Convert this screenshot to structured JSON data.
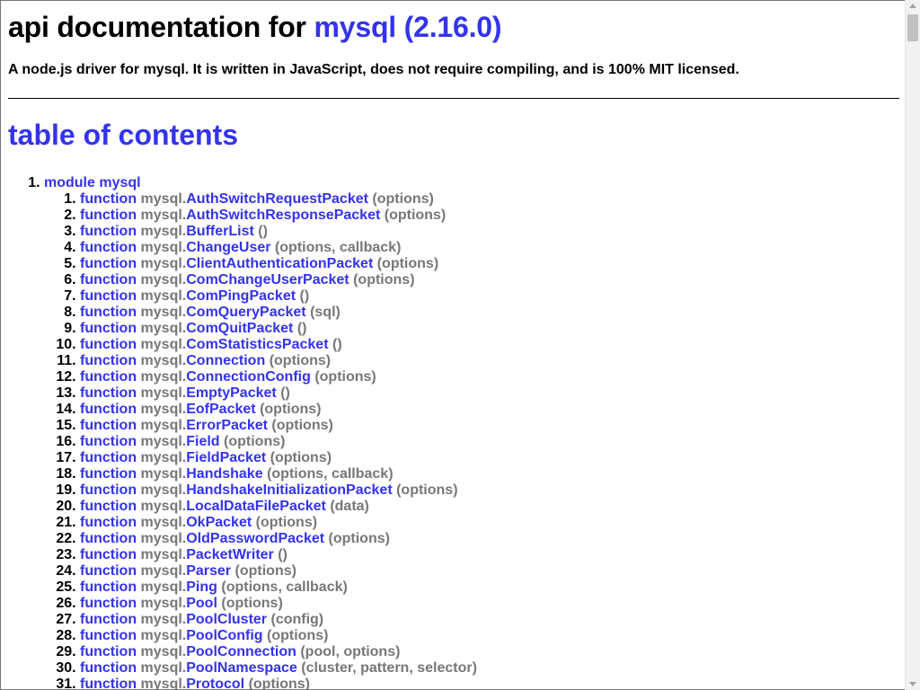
{
  "title": {
    "prefix": "api documentation for ",
    "link": "mysql (2.16.0)"
  },
  "description": "A node.js driver for mysql. It is written in JavaScript, does not require compiling, and is 100% MIT licensed.",
  "toc_heading": "table of contents",
  "module": {
    "label": "module mysql",
    "keyword": "function",
    "namespace": "mysql.",
    "functions": [
      {
        "name": "AuthSwitchRequestPacket",
        "args": "(options)"
      },
      {
        "name": "AuthSwitchResponsePacket",
        "args": "(options)"
      },
      {
        "name": "BufferList",
        "args": "()"
      },
      {
        "name": "ChangeUser",
        "args": "(options, callback)"
      },
      {
        "name": "ClientAuthenticationPacket",
        "args": "(options)"
      },
      {
        "name": "ComChangeUserPacket",
        "args": "(options)"
      },
      {
        "name": "ComPingPacket",
        "args": "()"
      },
      {
        "name": "ComQueryPacket",
        "args": "(sql)"
      },
      {
        "name": "ComQuitPacket",
        "args": "()"
      },
      {
        "name": "ComStatisticsPacket",
        "args": "()"
      },
      {
        "name": "Connection",
        "args": "(options)"
      },
      {
        "name": "ConnectionConfig",
        "args": "(options)"
      },
      {
        "name": "EmptyPacket",
        "args": "()"
      },
      {
        "name": "EofPacket",
        "args": "(options)"
      },
      {
        "name": "ErrorPacket",
        "args": "(options)"
      },
      {
        "name": "Field",
        "args": "(options)"
      },
      {
        "name": "FieldPacket",
        "args": "(options)"
      },
      {
        "name": "Handshake",
        "args": "(options, callback)"
      },
      {
        "name": "HandshakeInitializationPacket",
        "args": "(options)"
      },
      {
        "name": "LocalDataFilePacket",
        "args": "(data)"
      },
      {
        "name": "OkPacket",
        "args": "(options)"
      },
      {
        "name": "OldPasswordPacket",
        "args": "(options)"
      },
      {
        "name": "PacketWriter",
        "args": "()"
      },
      {
        "name": "Parser",
        "args": "(options)"
      },
      {
        "name": "Ping",
        "args": "(options, callback)"
      },
      {
        "name": "Pool",
        "args": "(options)"
      },
      {
        "name": "PoolCluster",
        "args": "(config)"
      },
      {
        "name": "PoolConfig",
        "args": "(options)"
      },
      {
        "name": "PoolConnection",
        "args": "(pool, options)"
      },
      {
        "name": "PoolNamespace",
        "args": "(cluster, pattern, selector)"
      },
      {
        "name": "Protocol",
        "args": "(options)"
      }
    ]
  }
}
